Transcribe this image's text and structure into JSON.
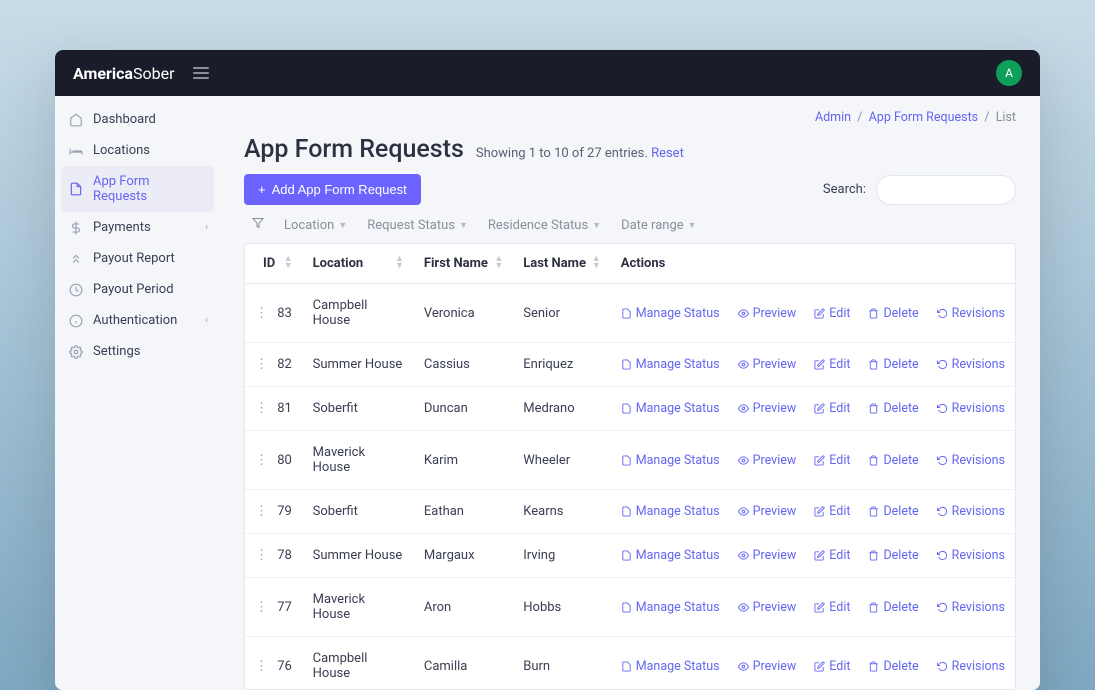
{
  "brand": {
    "bold": "America",
    "light": "Sober"
  },
  "avatar": "A",
  "sidebar": {
    "items": [
      {
        "label": "Dashboard",
        "icon": "home"
      },
      {
        "label": "Locations",
        "icon": "bed"
      },
      {
        "label": "App Form Requests",
        "icon": "file",
        "active": true
      },
      {
        "label": "Payments",
        "icon": "dollar",
        "chevron": true
      },
      {
        "label": "Payout Report",
        "icon": "up"
      },
      {
        "label": "Payout Period",
        "icon": "clock"
      },
      {
        "label": "Authentication",
        "icon": "info",
        "chevron": true
      },
      {
        "label": "Settings",
        "icon": "gear"
      }
    ]
  },
  "breadcrumb": {
    "admin": "Admin",
    "mid": "App Form Requests",
    "last": "List",
    "sep": "/"
  },
  "page": {
    "title": "App Form Requests",
    "entries": "Showing 1 to 10 of 27 entries.",
    "reset": "Reset"
  },
  "toolbar": {
    "add_label": "Add App Form Request",
    "search_label": "Search:"
  },
  "filters": [
    "Location",
    "Request Status",
    "Residence Status",
    "Date range"
  ],
  "columns": {
    "id": "ID",
    "location": "Location",
    "first": "First Name",
    "last": "Last Name",
    "actions": "Actions"
  },
  "action_labels": {
    "manage": "Manage Status",
    "preview": "Preview",
    "edit": "Edit",
    "delete": "Delete",
    "revisions": "Revisions"
  },
  "rows": [
    {
      "id": "83",
      "location": "Campbell House",
      "first": "Veronica",
      "last": "Senior"
    },
    {
      "id": "82",
      "location": "Summer House",
      "first": "Cassius",
      "last": "Enriquez"
    },
    {
      "id": "81",
      "location": "Soberfit",
      "first": "Duncan",
      "last": "Medrano"
    },
    {
      "id": "80",
      "location": "Maverick House",
      "first": "Karim",
      "last": "Wheeler"
    },
    {
      "id": "79",
      "location": "Soberfit",
      "first": "Eathan",
      "last": "Kearns"
    },
    {
      "id": "78",
      "location": "Summer House",
      "first": "Margaux",
      "last": "Irving"
    },
    {
      "id": "77",
      "location": "Maverick House",
      "first": "Aron",
      "last": "Hobbs"
    },
    {
      "id": "76",
      "location": "Campbell House",
      "first": "Camilla",
      "last": "Burn"
    }
  ]
}
